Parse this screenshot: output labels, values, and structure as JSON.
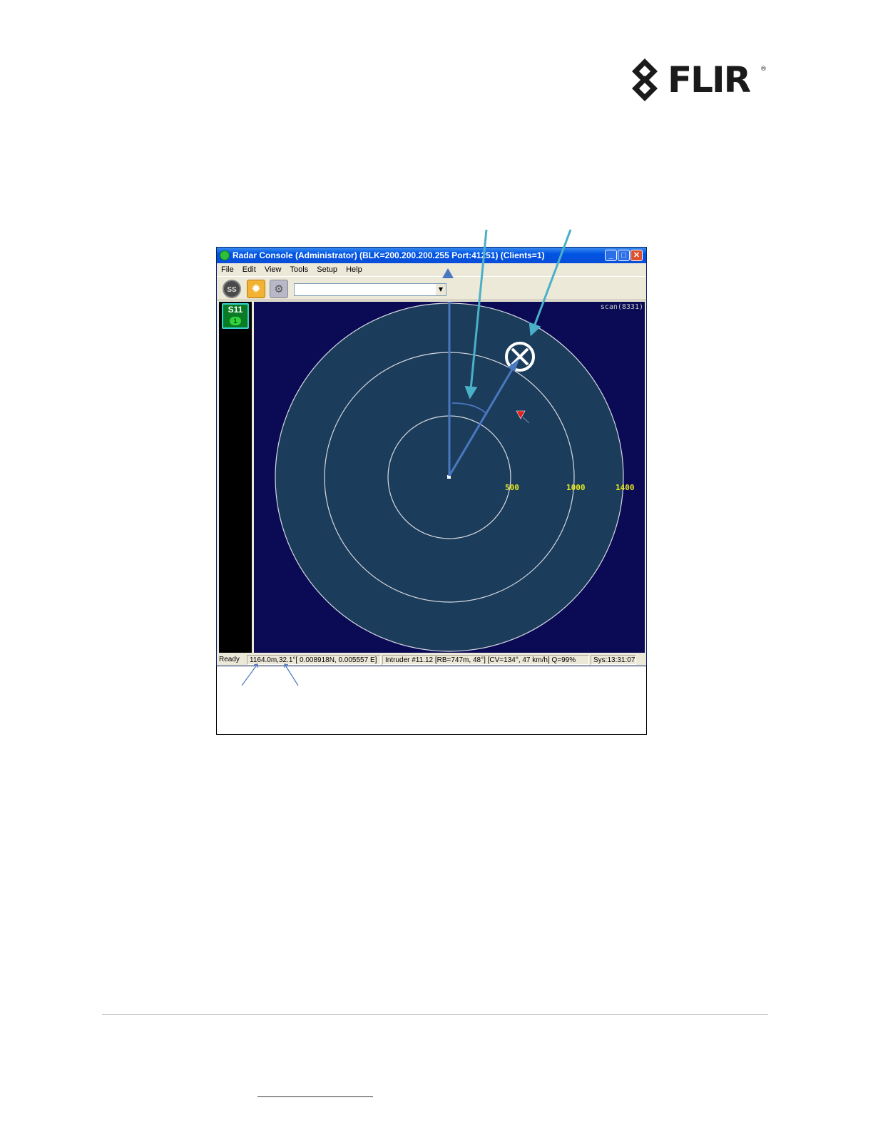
{
  "logo": {
    "text": "FLIR",
    "reg": "®"
  },
  "window": {
    "title": "Radar Console (Administrator) (BLK=200.200.200.255 Port:41251) (Clients=1)",
    "controls": {
      "minimize": "_",
      "maximize": "□",
      "close": "✕"
    }
  },
  "menu": [
    "File",
    "Edit",
    "View",
    "Tools",
    "Setup",
    "Help"
  ],
  "toolbar": {
    "ss_label": "SS",
    "combo_value": "",
    "combo_arrow": "▼"
  },
  "sidepanel": {
    "sensor_label": "S11",
    "sensor_count": "1"
  },
  "radar": {
    "scan_label": "scan(8331)",
    "range_labels": [
      "500",
      "1000",
      "1400"
    ],
    "colors": {
      "background": "#0a0a55",
      "scope": "#1b3d5b",
      "rings": "#d8d8e0",
      "labels": "#e8e820",
      "target": "#e02020",
      "arrow": "#4a78c0"
    }
  },
  "statusbar": {
    "ready": "Ready",
    "range_bearing": "1164.0m,32.1°",
    "coords": "[ 0.008918N,  0.005557 E]",
    "intruder": "Intruder #11.12 [RB=747m, 48°] [CV=134°, 47 km/h] Q=99%",
    "sys_time": "Sys:13:31:07"
  },
  "icons": [
    "app-icon",
    "ss-icon",
    "sun-icon",
    "gear-icon",
    "cursor-crosshair-icon",
    "target-triangle-icon"
  ]
}
